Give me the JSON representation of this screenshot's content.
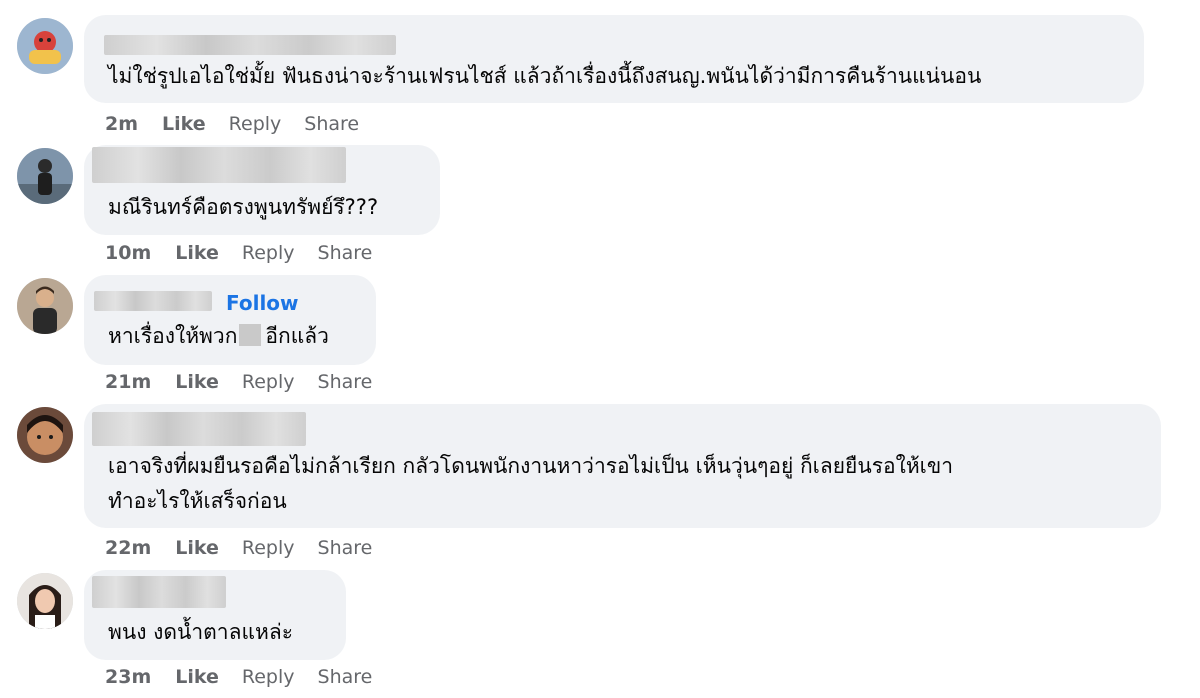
{
  "comments": [
    {
      "text": "ไม่ใช่รูปเอไอใช่มั้ย ฟันธงน่าจะร้านเฟรนไชส์ แล้วถ้าเรื่องนี้ถึงสนญ.พนันได้ว่ามีการคืนร้านแน่นอน",
      "time": "2m",
      "like": "Like",
      "reply": "Reply",
      "share": "Share"
    },
    {
      "text": "มณีรินทร์คือตรงพูนทรัพย์รึ???",
      "time": "10m",
      "like": "Like",
      "reply": "Reply",
      "share": "Share"
    },
    {
      "follow": "Follow",
      "text_before": "หาเรื่องให้พวก",
      "text_after": "อีกแล้ว",
      "time": "21m",
      "like": "Like",
      "reply": "Reply",
      "share": "Share"
    },
    {
      "text_line1": "เอาจริงที่ผมยืนรอคือไม่กล้าเรียก กลัวโดนพนักงานหาว่ารอไม่เป็น เห็นวุ่นๆอยู่ ก็เลยยืนรอให้เขา",
      "text_line2": "ทำอะไรให้เสร็จก่อน",
      "time": "22m",
      "like": "Like",
      "reply": "Reply",
      "share": "Share"
    },
    {
      "text": "พนง งดน้ำตาลแหล่ะ",
      "time": "23m",
      "like": "Like",
      "reply": "Reply",
      "share": "Share"
    }
  ]
}
